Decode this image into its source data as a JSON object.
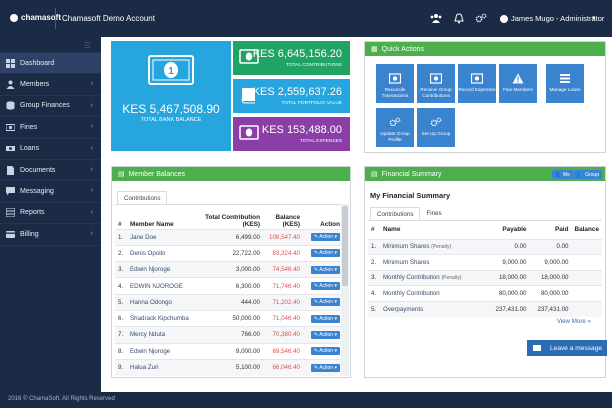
{
  "topbar": {
    "logo_text": "chamasoft",
    "app_title": "Chamasoft Demo Account",
    "user_name": "James Mugo - Administrator",
    "icons": [
      "users-icon",
      "bell-icon",
      "cogs-icon",
      "user-avatar-icon"
    ]
  },
  "sidebar": {
    "items": [
      {
        "label": "Dashboard",
        "icon": "dashboard-icon",
        "active": true,
        "chevron": false
      },
      {
        "label": "Members",
        "icon": "users-icon",
        "active": false,
        "chevron": true
      },
      {
        "label": "Group Finances",
        "icon": "coins-icon",
        "active": false,
        "chevron": true
      },
      {
        "label": "Fines",
        "icon": "money-icon",
        "active": false,
        "chevron": true
      },
      {
        "label": "Loans",
        "icon": "cash-icon",
        "active": false,
        "chevron": true
      },
      {
        "label": "Documents",
        "icon": "document-icon",
        "active": false,
        "chevron": true
      },
      {
        "label": "Messaging",
        "icon": "messaging-icon",
        "active": false,
        "chevron": true
      },
      {
        "label": "Reports",
        "icon": "reports-icon",
        "active": false,
        "chevron": true
      },
      {
        "label": "Billing",
        "icon": "billing-icon",
        "active": false,
        "chevron": true
      }
    ]
  },
  "tiles": {
    "bank_balance": {
      "amount": "KES 5,467,508.90",
      "label": "TOTAL BANK BALANCE",
      "color": "#26a5de"
    },
    "contributions": {
      "amount": "KES 6,645,156.20",
      "label": "TOTAL CONTRIBUTIONS",
      "color": "#1fa463"
    },
    "portfolio": {
      "amount": "KES 2,559,637.26",
      "label": "TOTAL PORTFOLIO VALUE",
      "color": "#26a5de"
    },
    "expenses": {
      "amount": "KES 153,488.00",
      "label": "TOTAL EXPENSES",
      "color": "#8b3ea8"
    }
  },
  "quick_actions": {
    "title": "Quick Actions",
    "items": [
      {
        "label": "Reconcile Transactions",
        "icon": "reconcile-icon"
      },
      {
        "label": "Receive Group Contributions",
        "icon": "receive-icon"
      },
      {
        "label": "Record Expenses",
        "icon": "expenses-icon"
      },
      {
        "label": "Fine Members",
        "icon": "warning-icon"
      },
      {
        "label": "Manage Loans",
        "icon": "list-icon"
      },
      {
        "label": "Update Group Profile",
        "icon": "profile-icon"
      },
      {
        "label": "Set Up Group",
        "icon": "setup-icon"
      }
    ]
  },
  "member_balances": {
    "title": "Member Balances",
    "tab": "Contributions",
    "headers": {
      "num": "#",
      "name": "Member Name",
      "total": "Total Contribution (KES)",
      "balance": "Balance (KES)",
      "action": "Action"
    },
    "action_label": "Action",
    "rows": [
      {
        "num": "1.",
        "name": "Jane Doe",
        "total": "6,499.00",
        "balance": "108,547.40"
      },
      {
        "num": "2.",
        "name": "Denis Opollo",
        "total": "22,722.00",
        "balance": "83,324.40"
      },
      {
        "num": "3.",
        "name": "Edwin Njoroge",
        "total": "3,000.00",
        "balance": "74,546.40"
      },
      {
        "num": "4.",
        "name": "EDWIN NJOROGE",
        "total": "6,300.00",
        "balance": "71,746.40"
      },
      {
        "num": "5.",
        "name": "Hanna Odongo",
        "total": "444.00",
        "balance": "71,202.40"
      },
      {
        "num": "6.",
        "name": "Shadrack Kipchumba",
        "total": "50,000.00",
        "balance": "71,046.40"
      },
      {
        "num": "7.",
        "name": "Mercy Nduta",
        "total": "766.00",
        "balance": "70,380.40"
      },
      {
        "num": "8.",
        "name": "Edwin Njoroge",
        "total": "9,000.00",
        "balance": "69,546.40"
      },
      {
        "num": "9.",
        "name": "Halua Zuri",
        "total": "5,100.00",
        "balance": "66,046.40"
      }
    ]
  },
  "financial_summary": {
    "title": "Financial Summary",
    "subtitle": "My Financial Summary",
    "me_label": "Me",
    "group_label": "Group",
    "tabs": [
      "Contributions",
      "Fines"
    ],
    "headers": {
      "num": "#",
      "name": "Name",
      "payable": "Payable",
      "paid": "Paid",
      "balance": "Balance"
    },
    "rows": [
      {
        "num": "1.",
        "name": "Minimum Shares",
        "note": "(Penalty)",
        "payable": "0.00",
        "paid": "0.00",
        "balance": ""
      },
      {
        "num": "2.",
        "name": "Minimum Shares",
        "note": "",
        "payable": "9,000.00",
        "paid": "9,000.00",
        "balance": ""
      },
      {
        "num": "3.",
        "name": "Monthly Contribution",
        "note": "(Penalty)",
        "payable": "18,000.00",
        "paid": "18,000.00",
        "balance": ""
      },
      {
        "num": "4.",
        "name": "Monthly Contribution",
        "note": "",
        "payable": "80,000.00",
        "paid": "80,000.00",
        "balance": ""
      },
      {
        "num": "5.",
        "name": "Overpayments",
        "note": "",
        "payable": "237,431.00",
        "paid": "237,431.00",
        "balance": ""
      }
    ],
    "view_more": "View More »"
  },
  "leave_message": "Leave a message",
  "footer": "2016 © ChamaSoft. All Rights Reserved"
}
